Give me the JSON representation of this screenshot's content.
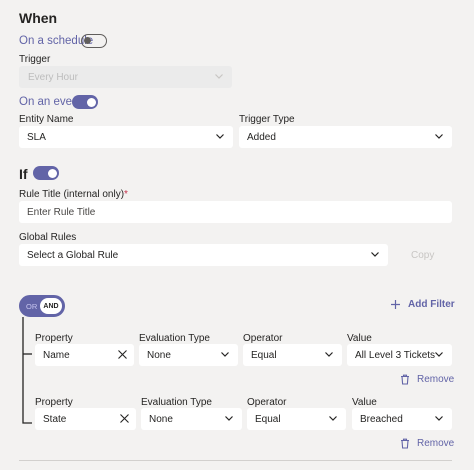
{
  "when": {
    "title": "When",
    "schedule_label": "On a schedule",
    "schedule_on": false,
    "trigger_label": "Trigger",
    "trigger_value": "Every Hour",
    "event_label": "On an event",
    "event_on": true,
    "entity_label": "Entity Name",
    "entity_value": "SLA",
    "trigger_type_label": "Trigger Type",
    "trigger_type_value": "Added"
  },
  "if": {
    "title": "If",
    "on": true,
    "rule_title_label": "Rule Title (internal only)",
    "required_mark": "*",
    "rule_title_placeholder": "Enter Rule Title",
    "global_rules_label": "Global Rules",
    "global_rules_placeholder": "Select a Global Rule",
    "copy_label": "Copy"
  },
  "logic": {
    "or_label": "OR",
    "and_label": "AND",
    "add_filter_label": "Add Filter"
  },
  "filters": [
    {
      "property_label": "Property",
      "property_value": "Name",
      "eval_label": "Evaluation Type",
      "eval_value": "None",
      "operator_label": "Operator",
      "operator_value": "Equal",
      "value_label": "Value",
      "value_value": "All Level 3 Tickets",
      "remove_label": "Remove"
    },
    {
      "property_label": "Property",
      "property_value": "State",
      "eval_label": "Evaluation Type",
      "eval_value": "None",
      "operator_label": "Operator",
      "operator_value": "Equal",
      "value_label": "Value",
      "value_value": "Breached",
      "remove_label": "Remove"
    }
  ],
  "colors": {
    "accent": "#6264a7",
    "background": "#f3f2f1",
    "field": "#ffffff",
    "required": "#c4314b"
  }
}
